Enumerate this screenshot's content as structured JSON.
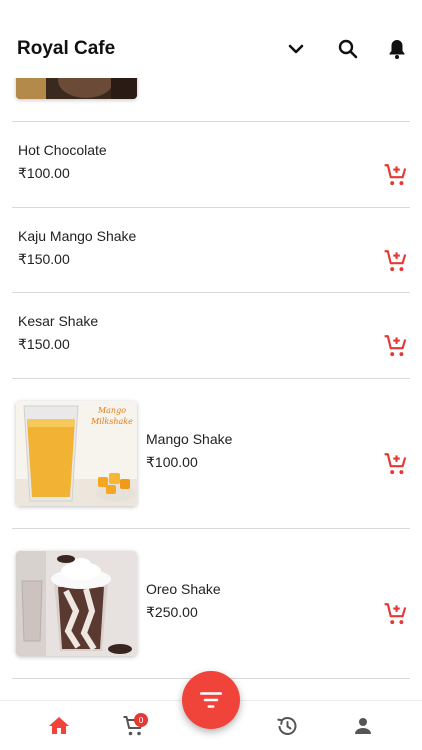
{
  "app": {
    "title": "Royal Cafe",
    "accent_color": "#f0433a",
    "cart_color": "#e53935",
    "icons": {
      "dropdown": "chevron-down-icon",
      "search": "search-icon",
      "notifications": "bell-icon"
    }
  },
  "menu_items": [
    {
      "name": "Hot Chocolate",
      "price": "₹100.00",
      "has_image": false
    },
    {
      "name": "Kaju Mango Shake",
      "price": "₹150.00",
      "has_image": false
    },
    {
      "name": "Kesar Shake",
      "price": "₹150.00",
      "has_image": false
    },
    {
      "name": "Mango Shake",
      "price": "₹100.00",
      "has_image": true,
      "image_caption": "Mango Milkshake"
    },
    {
      "name": "Oreo Shake",
      "price": "₹250.00",
      "has_image": true
    }
  ],
  "bottom_nav": {
    "items": [
      {
        "icon": "home-icon",
        "active": true
      },
      {
        "icon": "cart-icon",
        "badge": "0"
      },
      {
        "icon": "history-icon"
      },
      {
        "icon": "profile-icon"
      }
    ],
    "fab_icon": "filter-icon"
  }
}
